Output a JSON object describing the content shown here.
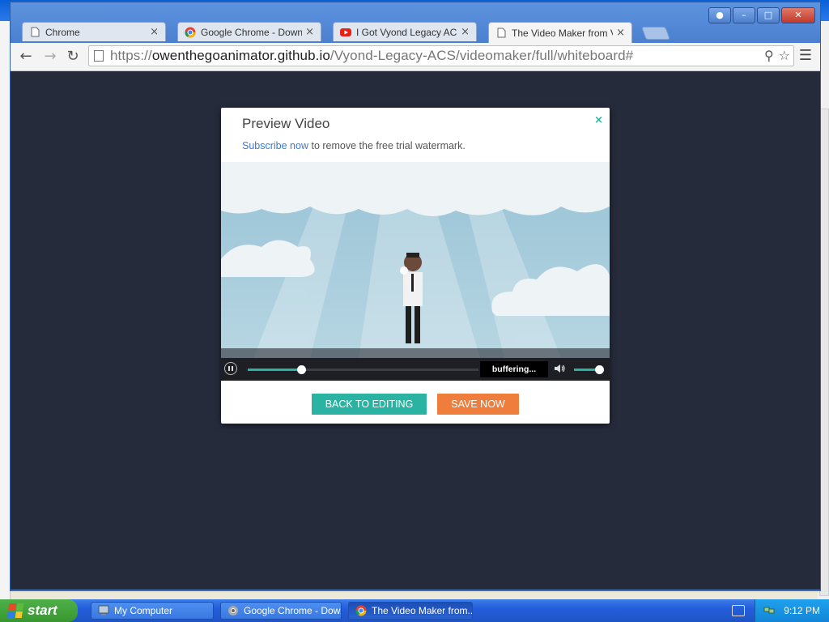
{
  "chrome": {
    "tabs": [
      {
        "label": "Chrome",
        "icon": "page-icon"
      },
      {
        "label": "Google Chrome - Download t",
        "icon": "chrome-icon"
      },
      {
        "label": "I Got Vyond Legacy ACS",
        "icon": "youtube-icon"
      },
      {
        "label": "The Video Maker from Vyond",
        "icon": "page-icon"
      }
    ],
    "tab_close": "×",
    "url_scheme": "https://",
    "url_host": "owenthegoanimator.github.io",
    "url_path": "/Vyond-Legacy-ACS/videomaker/full/whiteboard#"
  },
  "modal": {
    "title": "Preview Video",
    "close": "×",
    "subscribe_link": "Subscribe now",
    "subscribe_text": " to remove the free trial watermark.",
    "status": "buffering...",
    "progress": 0.23,
    "volume": 0.9,
    "back_button": "BACK TO EDITING",
    "save_button": "SAVE NOW",
    "accent": "#2ab3a3",
    "save_color": "#ef7d3c"
  },
  "taskbar": {
    "start": "start",
    "items": [
      {
        "label": "My Computer"
      },
      {
        "label": "Google Chrome - Dow..."
      },
      {
        "label": "The Video Maker from..."
      }
    ],
    "clock": "9:12 PM"
  }
}
